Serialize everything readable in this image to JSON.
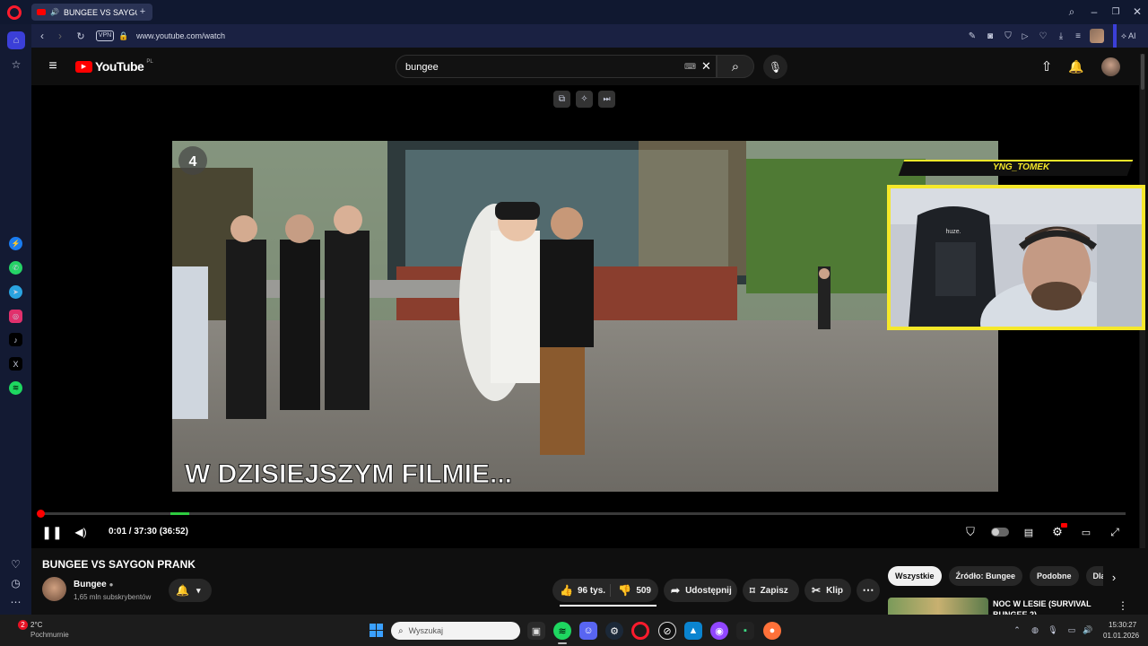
{
  "browser": {
    "tab_title": "BUNGEE VS SAYGON",
    "url": "www.youtube.com/watch",
    "vpn_label": "VPN",
    "ai_label": "AI"
  },
  "youtube": {
    "logo_text": "YouTube",
    "region": "PL",
    "search_value": "bungee"
  },
  "video": {
    "caption": "W DZISIEJSZYM FILMIE...",
    "channel_badge": "4",
    "streamer_name": "YNG_TOMEK",
    "chair_brand": "huze.",
    "time_display": "0:01 / 37:30 (36:52)",
    "progress_fraction": 0.0003,
    "title": "BUNGEE VS SAYGON PRANK"
  },
  "channel": {
    "name": "Bungee",
    "subscribers": "1,65 mln subskrybentów"
  },
  "actions": {
    "likes": "96 tys.",
    "dislikes": "509",
    "share": "Udostępnij",
    "save": "Zapisz",
    "clip": "Klip"
  },
  "filters": [
    "Wszystkie",
    "Źródło: Bungee",
    "Podobne",
    "Dla"
  ],
  "recommended": {
    "title_line1": "NOC W LESIE (SURVIVAL",
    "title_line2": "BUNGEE 2)"
  },
  "taskbar": {
    "weather_temp": "2°C",
    "weather_desc": "Pochmurnie",
    "notification_count": "2",
    "search_placeholder": "Wyszukaj",
    "time": "15:30:27",
    "date": "01.01.2026"
  },
  "colors": {
    "youtube_red": "#ff0000",
    "overlay_yellow": "#f5e82a",
    "sponsor_green": "#2ecc40"
  }
}
